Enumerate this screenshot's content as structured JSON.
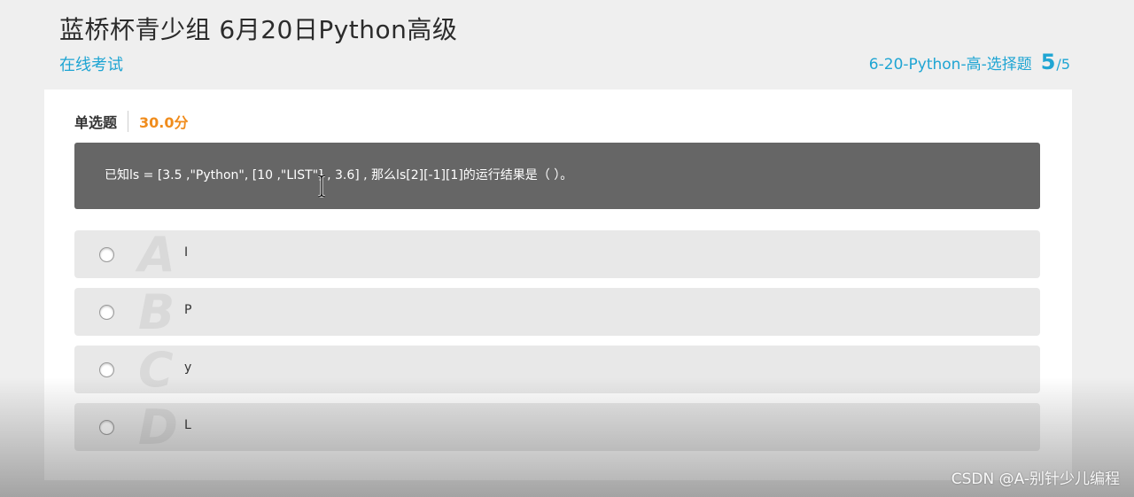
{
  "header": {
    "title": "蓝桥杯青少组 6月20日Python高级",
    "subtitle": "在线考试",
    "paper_name": "6-20-Python-高-选择题",
    "progress_current": "5",
    "progress_total": "/5"
  },
  "question": {
    "type_label": "单选题",
    "score": "30.0分",
    "stem": "已知ls = [3.5 ,\"Python\", [10 ,\"LIST\"] , 3.6] , 那么ls[2][-1][1]的运行结果是（   ）。",
    "options": [
      {
        "letter": "A",
        "text": "I"
      },
      {
        "letter": "B",
        "text": "P"
      },
      {
        "letter": "C",
        "text": "y"
      },
      {
        "letter": "D",
        "text": "L"
      }
    ]
  },
  "watermark": "CSDN @A-别针少儿编程",
  "colors": {
    "accent": "#1fa5d3",
    "score": "#f08c1c",
    "stem_bg": "#666666",
    "option_bg": "#e8e8e8"
  },
  "icons": {
    "cursor": "text-cursor-icon",
    "radio": "radio-icon"
  }
}
